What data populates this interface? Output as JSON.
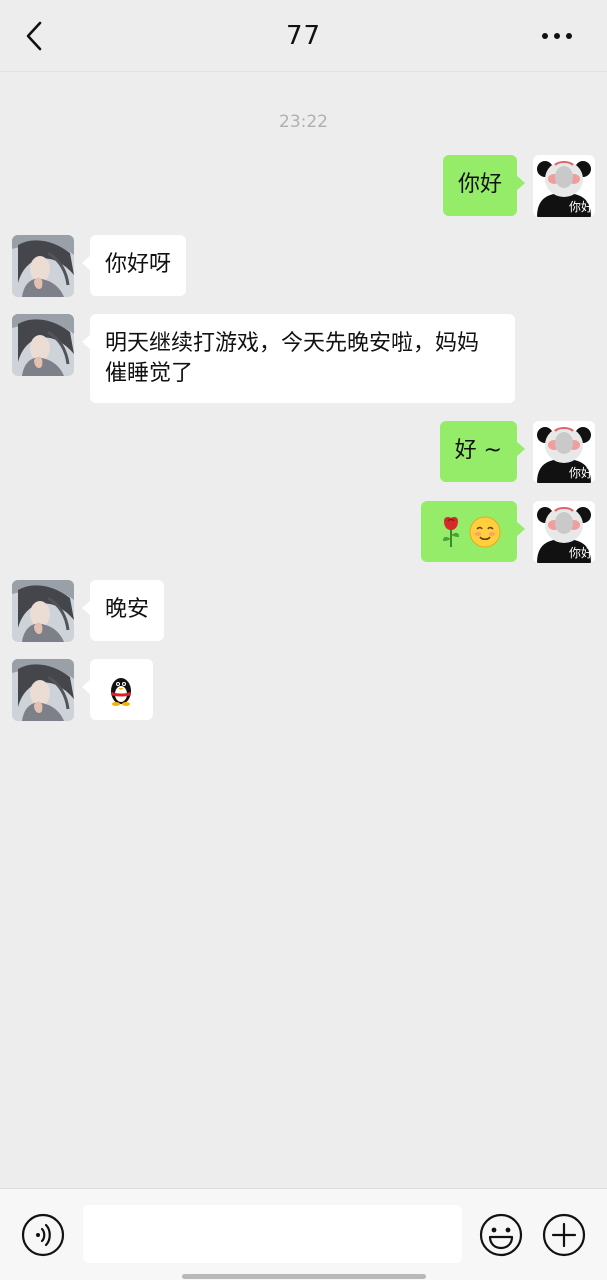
{
  "header": {
    "title": "77",
    "back_icon": "chevron-left-icon",
    "more_icon": "ellipsis-icon"
  },
  "conversation": {
    "timestamp": "23:22",
    "messages": [
      {
        "side": "right",
        "text": "你好"
      },
      {
        "side": "left",
        "text": "你好呀"
      },
      {
        "side": "left",
        "text": "明天继续打游戏，今天先晚安啦，妈妈催睡觉了"
      },
      {
        "side": "right",
        "text": "好 ~"
      },
      {
        "side": "right",
        "emoji": [
          "rose",
          "smile"
        ]
      },
      {
        "side": "left",
        "text": "晚安"
      },
      {
        "side": "left",
        "emoji": [
          "penguin"
        ]
      }
    ]
  },
  "self_avatar": {
    "caption": "你好"
  },
  "input_bar": {
    "voice_icon": "voice-icon",
    "emoji_icon": "emoji-face-icon",
    "plus_icon": "plus-circle-icon",
    "placeholder": ""
  },
  "colors": {
    "background": "#ededed",
    "sent_bubble": "#95ec69",
    "received_bubble": "#ffffff"
  }
}
